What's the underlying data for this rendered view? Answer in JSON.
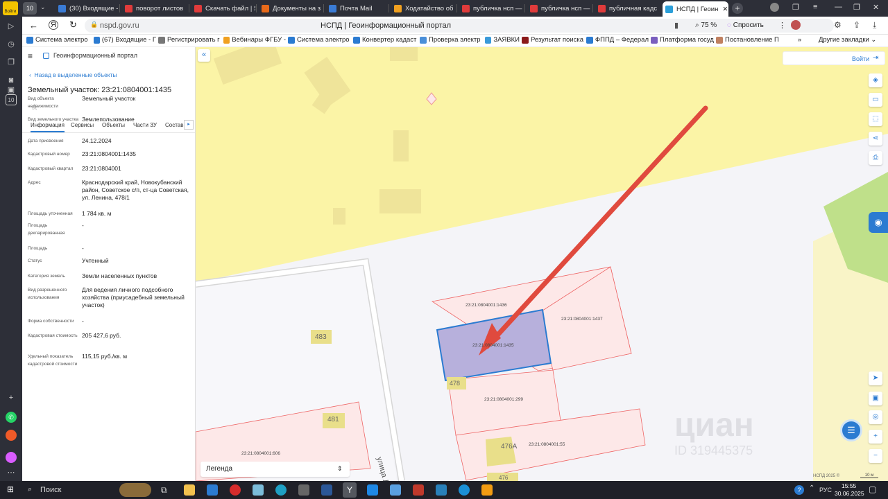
{
  "browser": {
    "tab_count": "10",
    "tabs": [
      {
        "label": "(30) Входящие -",
        "color": "#3a7bd5"
      },
      {
        "label": "поворот листов",
        "color": "#e03b3b"
      },
      {
        "label": "Скачать файл | Я",
        "color": "#e03b3b"
      },
      {
        "label": "Документы на з",
        "color": "#e86a1a"
      },
      {
        "label": "Почта Mail",
        "color": "#3a7bd5"
      },
      {
        "label": "Ходатайство об",
        "color": "#f0a020"
      },
      {
        "label": "публичка нсп —",
        "color": "#e03b3b"
      },
      {
        "label": "публичка нсп —",
        "color": "#e03b3b"
      },
      {
        "label": "публичная кадс",
        "color": "#e03b3b"
      }
    ],
    "active_tab": "НСПД | Геоин",
    "url": "nspd.gov.ru",
    "page_title": "НСПД | Геоинформационный портал",
    "zoom": "75 %",
    "ask_label": "Спросить",
    "bookmarks": [
      "Система электро",
      "(67) Входящие - Г",
      "Регистрировать г",
      "Вебинары ФГБУ -",
      "Система электро",
      "Конвертер кадаст",
      "Проверка электр",
      "ЗАЯВКИ",
      "Результат поиска",
      "ФППД – Федерал",
      "Платформа госуд",
      "Постановление П"
    ],
    "other_bookmarks": "Другие закладки"
  },
  "panel": {
    "app_title": "Геоинформационный портал",
    "back_link": "Назад в выделенные объекты",
    "object_title": "Земельный участок: 23:21:0804001:1435",
    "tabs": [
      "Информация",
      "Сервисы",
      "Объекты",
      "Части ЗУ",
      "Состав"
    ],
    "props": [
      {
        "k": "Вид объекта недвижимости",
        "v": "Земельный участок"
      },
      {
        "k": "Вид земельного участка",
        "v": "Землепользование"
      },
      {
        "k": "Дата присвоения",
        "v": "24.12.2024"
      },
      {
        "k": "Кадастровый номер",
        "v": "23:21:0804001:1435"
      },
      {
        "k": "Кадастровый квартал",
        "v": "23:21:0804001"
      },
      {
        "k": "Адрес",
        "v": "Краснодарский край, Новокубанский район, Советское с/п, ст-ца Советская, ул. Ленина, 478/1"
      },
      {
        "k": "Площадь уточненная",
        "v": "1 784 кв. м"
      },
      {
        "k": "Площадь декларированная",
        "v": "-"
      },
      {
        "k": "Площадь",
        "v": "-"
      },
      {
        "k": "Статус",
        "v": "Учтенный"
      },
      {
        "k": "Категория земель",
        "v": "Земли населенных пунктов"
      },
      {
        "k": "Вид разрешенного использования",
        "v": "Для ведения личного подсобного хозяйства (приусадебный земельный участок)"
      },
      {
        "k": "Форма собственности",
        "v": "-"
      },
      {
        "k": "Кадастровая стоимость",
        "v": "205 427,6 руб."
      },
      {
        "k": "Удельный показатель кадастровой стоимости",
        "v": "115,15 руб./кв. м"
      }
    ]
  },
  "map": {
    "login": "Войти",
    "legend": "Легенда",
    "parcels": [
      "23:21:0804001:1436",
      "23:21:0804001:1437",
      "23:21:0804001:1435",
      "23:21:0804001:299",
      "23:21:0804001:55",
      "23:21:0804001:606"
    ],
    "houses": [
      "483",
      "481",
      "478",
      "476А",
      "476"
    ],
    "street": "улица Л",
    "watermark": "циан",
    "watermark_id": "ID 319445375",
    "copyright": "НСПД 2025 ©",
    "scale": "10 м"
  },
  "taskbar": {
    "search": "Поиск",
    "lang": "РУС",
    "time": "15:55",
    "date": "30.06.2025"
  }
}
